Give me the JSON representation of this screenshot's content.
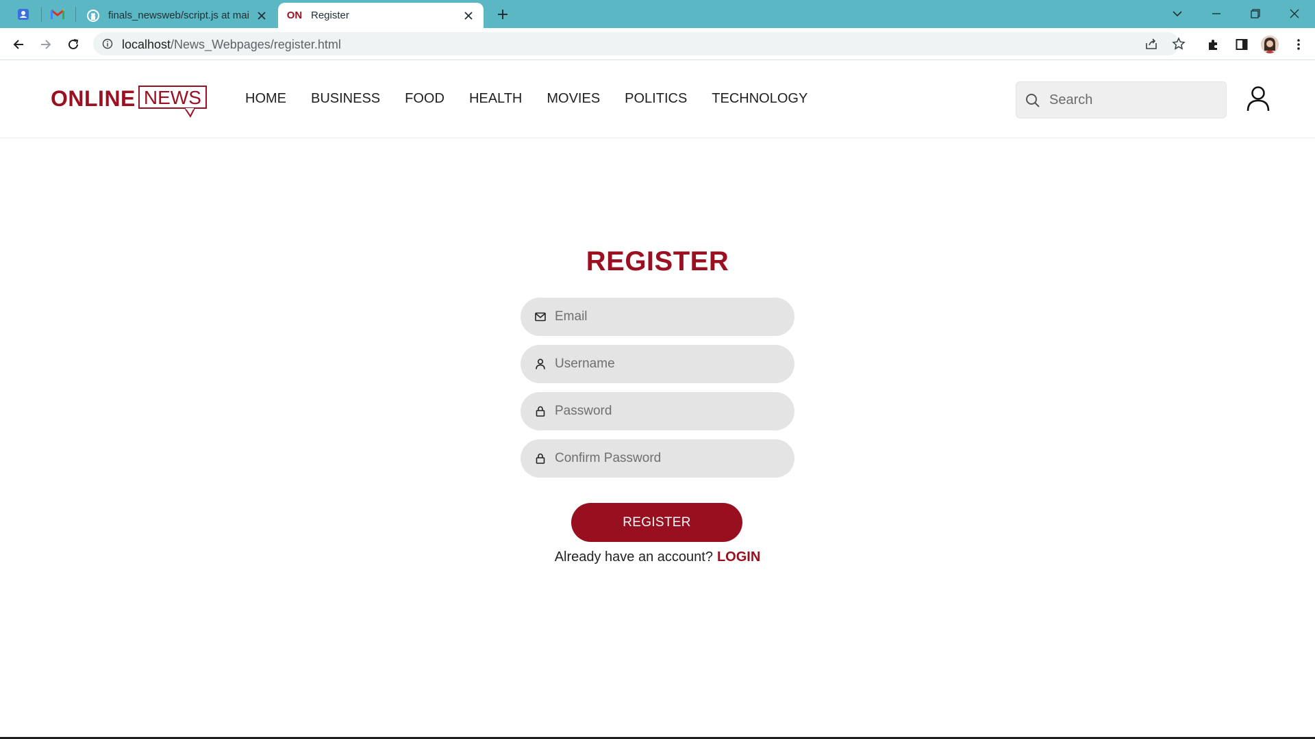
{
  "browser": {
    "tabs": [
      {
        "title": "finals_newsweb/script.js at main",
        "favicon": "github-icon",
        "active": false
      },
      {
        "title": "Register",
        "favicon_text": "ON",
        "active": true
      }
    ],
    "address": {
      "host": "localhost",
      "path": "/News_Webpages/register.html"
    }
  },
  "site": {
    "logo": {
      "online": "ONLINE",
      "news": "NEWS"
    },
    "nav": [
      "HOME",
      "BUSINESS",
      "FOOD",
      "HEALTH",
      "MOVIES",
      "POLITICS",
      "TECHNOLOGY"
    ],
    "search": {
      "placeholder": "Search"
    }
  },
  "form": {
    "title": "REGISTER",
    "fields": [
      {
        "placeholder": "Email",
        "icon": "mail-icon"
      },
      {
        "placeholder": "Username",
        "icon": "user-icon"
      },
      {
        "placeholder": "Password",
        "icon": "lock-icon"
      },
      {
        "placeholder": "Confirm Password",
        "icon": "lock-icon"
      }
    ],
    "submit_label": "REGISTER",
    "login_prompt": "Already have an account?",
    "login_link": "LOGIN"
  },
  "colors": {
    "brand": "#9b1020",
    "tabbar": "#5bb7c3",
    "field_bg": "#e4e4e4"
  }
}
